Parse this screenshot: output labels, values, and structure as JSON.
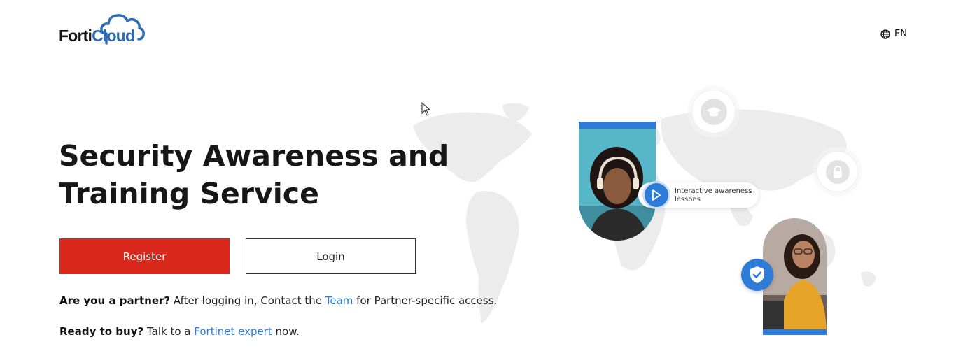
{
  "header": {
    "logo": {
      "part1": "Forti",
      "part2": "Cloud"
    },
    "language": {
      "label": "EN",
      "icon": "globe-icon"
    }
  },
  "hero": {
    "title": "Security Awareness and Training Service",
    "register_label": "Register",
    "login_label": "Login",
    "partner_line": {
      "bold": "Are you a partner?",
      "before_link": " After logging in, Contact the ",
      "link": "Team",
      "after_link": " for Partner-specific access."
    },
    "buy_line": {
      "bold": "Ready to buy?",
      "before_link": " Talk to a ",
      "link": "Fortinet expert",
      "after_link": " now."
    }
  },
  "illustration": {
    "lesson_pill": "Interactive awareness lessons",
    "icons": [
      "graduation-cap-icon",
      "lock-icon",
      "play-icon",
      "shield-check-icon"
    ]
  },
  "colors": {
    "brand_red": "#da291c",
    "link_blue": "#2a7dd8",
    "accent_blue": "#2e7bd8",
    "logo_blue": "#2d6bb3"
  }
}
